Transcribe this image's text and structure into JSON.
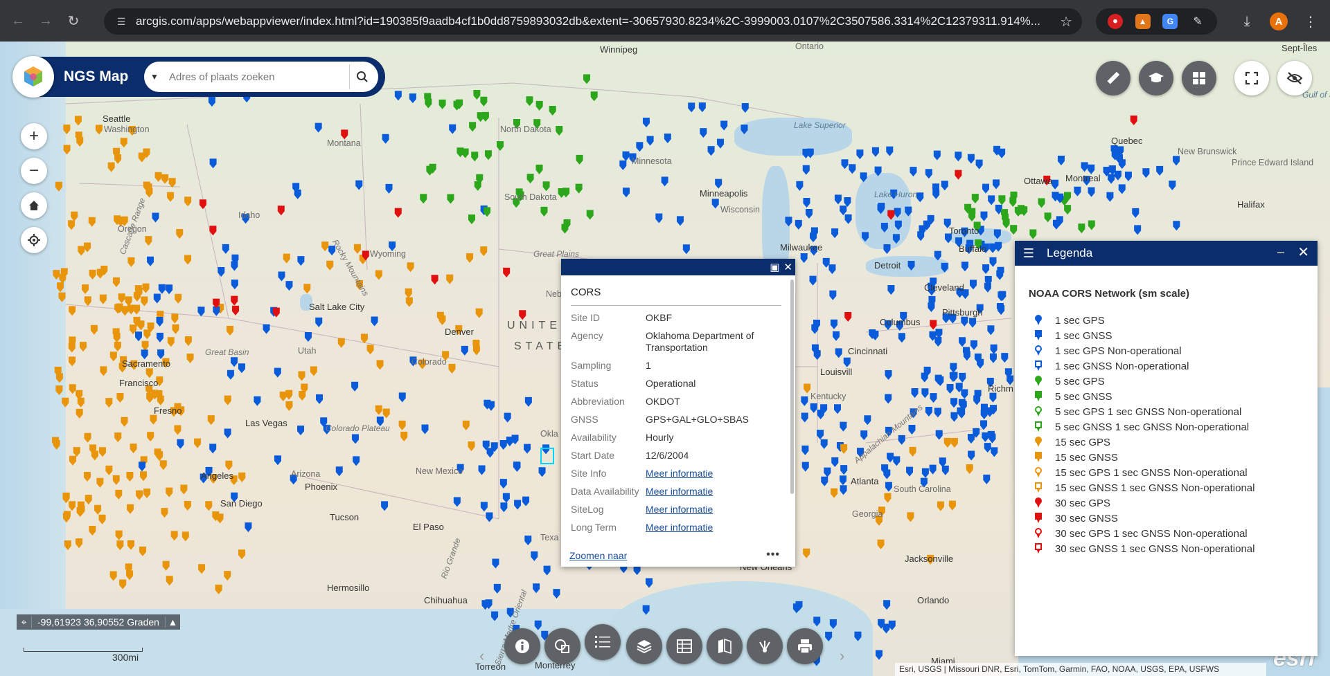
{
  "browser": {
    "url": "arcgis.com/apps/webappviewer/index.html?id=190385f9aadb4cf1b0dd8759893032db&extent=-30657930.8234%2C-3999003.0107%2C3507586.3314%2C12379311.914%...",
    "profile_initial": "A"
  },
  "app": {
    "title": "NGS Map",
    "search_placeholder": "Adres of plaats zoeken"
  },
  "map": {
    "labels": [
      {
        "text": "Winnipeg",
        "kind": "city"
      },
      {
        "text": "Seattle",
        "kind": "city"
      },
      {
        "text": "Washington",
        "kind": "state"
      },
      {
        "text": "Montana",
        "kind": "state"
      },
      {
        "text": "North Dakota",
        "kind": "state"
      },
      {
        "text": "Minnesota",
        "kind": "state"
      },
      {
        "text": "South Dakota",
        "kind": "state"
      },
      {
        "text": "Minneapolis",
        "kind": "city"
      },
      {
        "text": "Wisconsin",
        "kind": "state"
      },
      {
        "text": "Oregon",
        "kind": "state"
      },
      {
        "text": "Idaho",
        "kind": "state"
      },
      {
        "text": "Wyoming",
        "kind": "state"
      },
      {
        "text": "Great Plains",
        "kind": "mountain"
      },
      {
        "text": "Nebraska",
        "kind": "state"
      },
      {
        "text": "Salt Lake City",
        "kind": "city"
      },
      {
        "text": "Denver",
        "kind": "city"
      },
      {
        "text": "Utah",
        "kind": "state"
      },
      {
        "text": "Colorado",
        "kind": "state"
      },
      {
        "text": "Great Basin",
        "kind": "mountain"
      },
      {
        "text": "Sacramento",
        "kind": "city"
      },
      {
        "text": "Francisco",
        "kind": "city"
      },
      {
        "text": "Fresno",
        "kind": "city"
      },
      {
        "text": "Las Vegas",
        "kind": "city"
      },
      {
        "text": "Colorado Plateau",
        "kind": "mountain"
      },
      {
        "text": "Angeles",
        "kind": "city"
      },
      {
        "text": "San Diego",
        "kind": "city"
      },
      {
        "text": "Arizona",
        "kind": "state"
      },
      {
        "text": "Phoenix",
        "kind": "city"
      },
      {
        "text": "Tucson",
        "kind": "city"
      },
      {
        "text": "New Mexico",
        "kind": "state"
      },
      {
        "text": "El Paso",
        "kind": "city"
      },
      {
        "text": "Hermosillo",
        "kind": "city"
      },
      {
        "text": "Chihuahua",
        "kind": "city"
      },
      {
        "text": "Torreón",
        "kind": "city"
      },
      {
        "text": "Monterrey",
        "kind": "city"
      },
      {
        "text": "UNITED",
        "kind": "country"
      },
      {
        "text": "STATES",
        "kind": "country"
      },
      {
        "text": "Okla",
        "kind": "state"
      },
      {
        "text": "Texa",
        "kind": "state"
      },
      {
        "text": "New Orleans",
        "kind": "city"
      },
      {
        "text": "Lake Superior",
        "kind": "water"
      },
      {
        "text": "Lake Huron",
        "kind": "water"
      },
      {
        "text": "Milwaukee",
        "kind": "city"
      },
      {
        "text": "Detroit",
        "kind": "city"
      },
      {
        "text": "Toronto",
        "kind": "city"
      },
      {
        "text": "Buffalo",
        "kind": "city"
      },
      {
        "text": "Cleveland",
        "kind": "city"
      },
      {
        "text": "Pittsburgh",
        "kind": "city"
      },
      {
        "text": "Columbus",
        "kind": "city"
      },
      {
        "text": "Cincinnati",
        "kind": "city"
      },
      {
        "text": "Louisvill",
        "kind": "city"
      },
      {
        "text": "Kentucky",
        "kind": "state"
      },
      {
        "text": "Atlanta",
        "kind": "city"
      },
      {
        "text": "Georgia",
        "kind": "state"
      },
      {
        "text": "South Carolina",
        "kind": "state"
      },
      {
        "text": "Jacksonville",
        "kind": "city"
      },
      {
        "text": "Orlando",
        "kind": "city"
      },
      {
        "text": "Miami",
        "kind": "city"
      },
      {
        "text": "Richm",
        "kind": "city"
      },
      {
        "text": "Quebec",
        "kind": "city"
      },
      {
        "text": "Ottawa",
        "kind": "city"
      },
      {
        "text": "Montreal",
        "kind": "city"
      },
      {
        "text": "New Brunswick",
        "kind": "state"
      },
      {
        "text": "Prince Edward Island",
        "kind": "state"
      },
      {
        "text": "Halifax",
        "kind": "city"
      },
      {
        "text": "Gulf of St. Lawrence",
        "kind": "water"
      },
      {
        "text": "Ontario",
        "kind": "state"
      },
      {
        "text": "Sept-Îles",
        "kind": "city"
      },
      {
        "text": "Cascade Range",
        "kind": "mountain"
      },
      {
        "text": "Rocky Mountains",
        "kind": "mountain"
      },
      {
        "text": "Appalachian Mountains",
        "kind": "mountain"
      },
      {
        "text": "Rio Grande",
        "kind": "mountain"
      },
      {
        "text": "Sierra Madre Oriental",
        "kind": "mountain"
      }
    ],
    "coordinates": "-99,61923 36,90552 Graden",
    "scale_label": "300mi",
    "attribution": "Esri, USGS | Missouri DNR, Esri, TomTom, Garmin, FAO, NOAA, USGS, EPA, USFWS",
    "esri_logo": "esri"
  },
  "popup": {
    "title": "CORS",
    "rows": [
      {
        "key": "Site ID",
        "value": "OKBF"
      },
      {
        "key": "Agency",
        "value": "Oklahoma Department of Transportation"
      },
      {
        "key": "Sampling",
        "value": "1"
      },
      {
        "key": "Status",
        "value": "Operational"
      },
      {
        "key": "Abbreviation",
        "value": "OKDOT"
      },
      {
        "key": "GNSS",
        "value": "GPS+GAL+GLO+SBAS"
      },
      {
        "key": "Availability",
        "value": "Hourly"
      },
      {
        "key": "Start Date",
        "value": "12/6/2004"
      },
      {
        "key": "Site Info",
        "value": "Meer informatie"
      },
      {
        "key": "Data Availability",
        "value": "Meer informatie"
      },
      {
        "key": "SiteLog",
        "value": "Meer informatie"
      },
      {
        "key": "Long Term",
        "value": "Meer informatie"
      }
    ],
    "zoom_link": "Zoomen naar",
    "more": "•••"
  },
  "legend": {
    "title": "Legenda",
    "layer_title": "NOAA CORS Network (sm scale)",
    "items": [
      {
        "label": "1 sec GPS",
        "color": "#0a5bd9",
        "shape": "pin"
      },
      {
        "label": "1 sec GNSS",
        "color": "#0a5bd9",
        "shape": "square-pin"
      },
      {
        "label": "1 sec GPS Non-operational",
        "color": "#0a5bd9",
        "shape": "pin-hollow"
      },
      {
        "label": "1 sec GNSS Non-operational",
        "color": "#0a5bd9",
        "shape": "square-hollow"
      },
      {
        "label": "5 sec GPS",
        "color": "#2ca61b",
        "shape": "pin"
      },
      {
        "label": "5 sec GNSS",
        "color": "#2ca61b",
        "shape": "square-pin"
      },
      {
        "label": "5 sec GPS 1 sec GNSS Non-operational",
        "color": "#2ca61b",
        "shape": "pin-hollow"
      },
      {
        "label": "5 sec GNSS 1 sec GNSS Non-operational",
        "color": "#2ca61b",
        "shape": "square-hollow"
      },
      {
        "label": "15 sec GPS",
        "color": "#e8950b",
        "shape": "pin"
      },
      {
        "label": "15 sec GNSS",
        "color": "#e8950b",
        "shape": "square-pin"
      },
      {
        "label": "15 sec GPS 1 sec GNSS Non-operational",
        "color": "#e8950b",
        "shape": "pin-hollow"
      },
      {
        "label": "15 sec GNSS 1 sec GNSS Non-operational",
        "color": "#e8950b",
        "shape": "square-hollow"
      },
      {
        "label": "30 sec GPS",
        "color": "#e01010",
        "shape": "pin"
      },
      {
        "label": "30 sec GNSS",
        "color": "#e01010",
        "shape": "square-pin"
      },
      {
        "label": "30 sec GPS 1 sec GNSS Non-operational",
        "color": "#e01010",
        "shape": "pin-hollow"
      },
      {
        "label": "30 sec GNSS 1 sec GNSS Non-operational",
        "color": "#e01010",
        "shape": "square-hollow"
      }
    ]
  },
  "toolbar": {
    "buttons": [
      "about-icon",
      "select-icon",
      "legend-icon",
      "layers-icon",
      "attribute-table-icon",
      "query-icon",
      "share-icon",
      "print-icon"
    ]
  },
  "colors": {
    "header_bg": "#0b2d6b",
    "gps_1s": "#0a5bd9",
    "gps_5s": "#2ca61b",
    "gps_15s": "#e8950b",
    "gps_30s": "#e01010"
  }
}
